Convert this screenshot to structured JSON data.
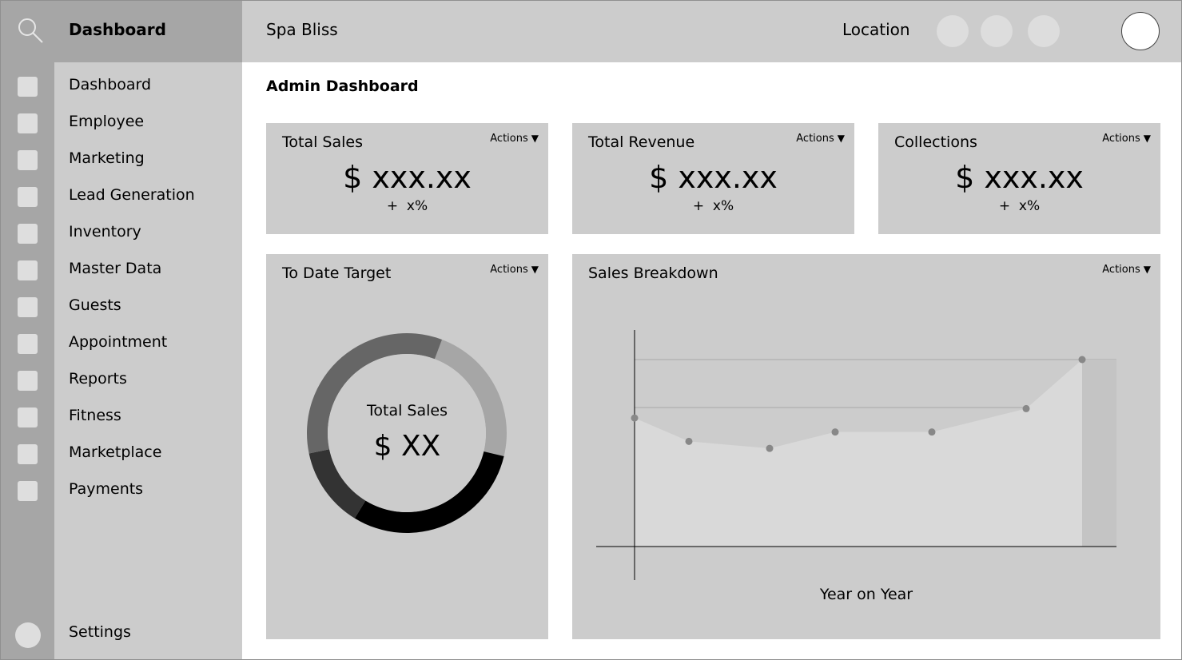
{
  "header": {
    "brand_title": "Dashboard",
    "app_name": "Spa Bliss",
    "location_label": "Location"
  },
  "sidebar": {
    "items": [
      {
        "label": "Dashboard"
      },
      {
        "label": "Employee"
      },
      {
        "label": "Marketing"
      },
      {
        "label": "Lead Generation"
      },
      {
        "label": "Inventory"
      },
      {
        "label": "Master Data"
      },
      {
        "label": "Guests"
      },
      {
        "label": "Appointment"
      },
      {
        "label": "Reports"
      },
      {
        "label": "Fitness"
      },
      {
        "label": "Marketplace"
      },
      {
        "label": "Payments"
      }
    ],
    "settings_label": "Settings"
  },
  "main": {
    "page_title": "Admin Dashboard",
    "actions_label": "Actions",
    "kpis": [
      {
        "title": "Total Sales",
        "value": "$ xxx.xx",
        "change": "+  x%"
      },
      {
        "title": "Total Revenue",
        "value": "$ xxx.xx",
        "change": "+  x%"
      },
      {
        "title": "Collections",
        "value": "$ xxx.xx",
        "change": "+  x%"
      }
    ],
    "target_card": {
      "title": "To Date Target",
      "center_label": "Total Sales",
      "center_value": "$ XX"
    },
    "breakdown_card": {
      "title": "Sales Breakdown"
    }
  },
  "chart_data": [
    {
      "type": "pie",
      "title": "To Date Target",
      "slices": [
        {
          "value": 0.23,
          "color": "#a6a6a6"
        },
        {
          "value": 0.3,
          "color": "#000000"
        },
        {
          "value": 0.13,
          "color": "#333333"
        },
        {
          "value": 0.34,
          "color": "#666666"
        }
      ]
    },
    {
      "type": "area",
      "title": "Sales Breakdown",
      "xlabel": "Year on Year",
      "ylabel": "",
      "x": [
        0,
        1,
        2,
        3,
        4,
        5,
        6
      ],
      "values": [
        2.75,
        2.25,
        2.1,
        2.45,
        2.45,
        2.95,
        4.0
      ],
      "ylim": [
        0,
        4
      ],
      "grid": true
    }
  ],
  "colors": {
    "header_bg": "#cccccc",
    "rail_bg": "#a6a6a6",
    "card_bg": "#cccccc",
    "area_fill": "#d9d9d9",
    "point_color": "#888888"
  }
}
